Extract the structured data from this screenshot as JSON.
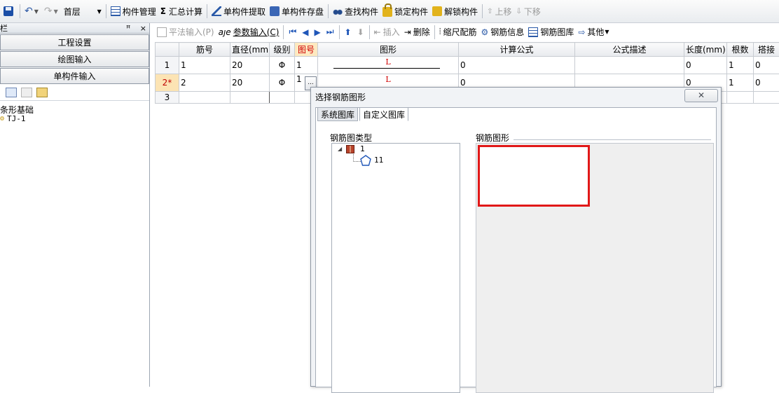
{
  "toolbar": {
    "floor_value": "首层",
    "items": {
      "component_manage": "构件管理",
      "sum_calc": "汇总计算",
      "single_extract": "单构件提取",
      "single_save": "单构件存盘",
      "find_component": "查找构件",
      "lock_component": "锁定构件",
      "unlock_component": "解锁构件",
      "move_up": "上移",
      "move_down": "下移"
    },
    "sigma": "Σ"
  },
  "left_panel": {
    "title": "栏",
    "pin": "ᵖ",
    "close": "×",
    "nav": [
      "工程设置",
      "绘图输入",
      "单构件输入"
    ],
    "tree_root": "条形基础",
    "tree_child": "TJ-1"
  },
  "grid_toolbar": {
    "flat_input": "平法输入(P)",
    "param_input": "参数输入(C)",
    "insert": "插入",
    "delete": "删除",
    "scale_rebar": "缩尺配筋",
    "rebar_info": "钢筋信息",
    "rebar_library": "钢筋图库",
    "other": "其他"
  },
  "grid": {
    "columns": [
      "",
      "筋号",
      "直径(mm)",
      "级别",
      "图号",
      "图形",
      "计算公式",
      "公式描述",
      "长度(mm)",
      "根数",
      "搭接"
    ],
    "rows": [
      {
        "row": "1",
        "bar_no": "1",
        "diameter": "20",
        "grade": "Φ",
        "fig_no": "1",
        "shape_label": "L",
        "formula": "0",
        "desc": "",
        "length": "0",
        "count": "1",
        "lap": "0"
      },
      {
        "row": "2*",
        "bar_no": "2",
        "diameter": "20",
        "grade": "Φ",
        "fig_no": "1",
        "shape_label": "L",
        "formula": "0",
        "desc": "",
        "length": "0",
        "count": "1",
        "lap": "0"
      },
      {
        "row": "3",
        "bar_no": "",
        "diameter": "",
        "grade": "",
        "fig_no": "",
        "shape_label": "",
        "formula": "",
        "desc": "",
        "length": "",
        "count": "",
        "lap": ""
      }
    ],
    "ellipsis": "..."
  },
  "dialog": {
    "title": "选择钢筋图形",
    "close": "✕",
    "tabs": [
      "系统图库",
      "自定义图库"
    ],
    "active_tab": "自定义图库",
    "type_group_label": "钢筋图类型",
    "shape_group_label": "钢筋图形",
    "tree": {
      "root": "1",
      "child": "11"
    },
    "selection_color": "#e11818"
  }
}
